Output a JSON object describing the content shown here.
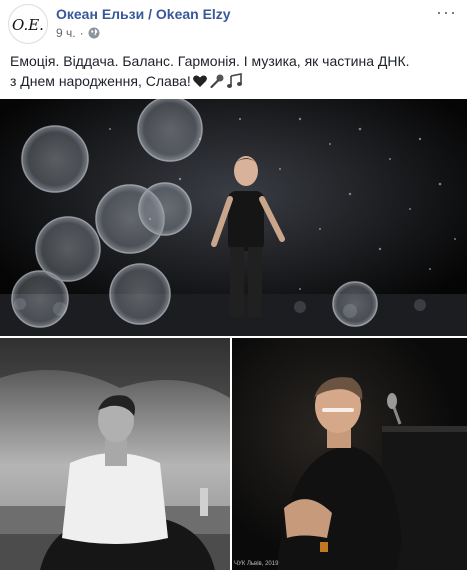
{
  "page": {
    "name": "Океан Ельзи / Okean Elzy",
    "avatar_text": "O.E.",
    "timestamp": "9 ч.",
    "privacy_icon": "globe-icon",
    "more_icon": "ellipsis-icon"
  },
  "post": {
    "line1": "Емоція. Віддача. Баланс. Гармонія. І музика, як частина ДНК.",
    "line2": "з Днем народження, Слава!",
    "emojis": [
      "black-heart-icon",
      "microphone-icon",
      "musical-notes-icon"
    ]
  },
  "photos": {
    "main": {
      "name": "concert-photo"
    },
    "left": {
      "name": "meditation-photo"
    },
    "right": {
      "name": "piano-photo",
      "caption": "ЧУК   Львів, 2019"
    }
  }
}
